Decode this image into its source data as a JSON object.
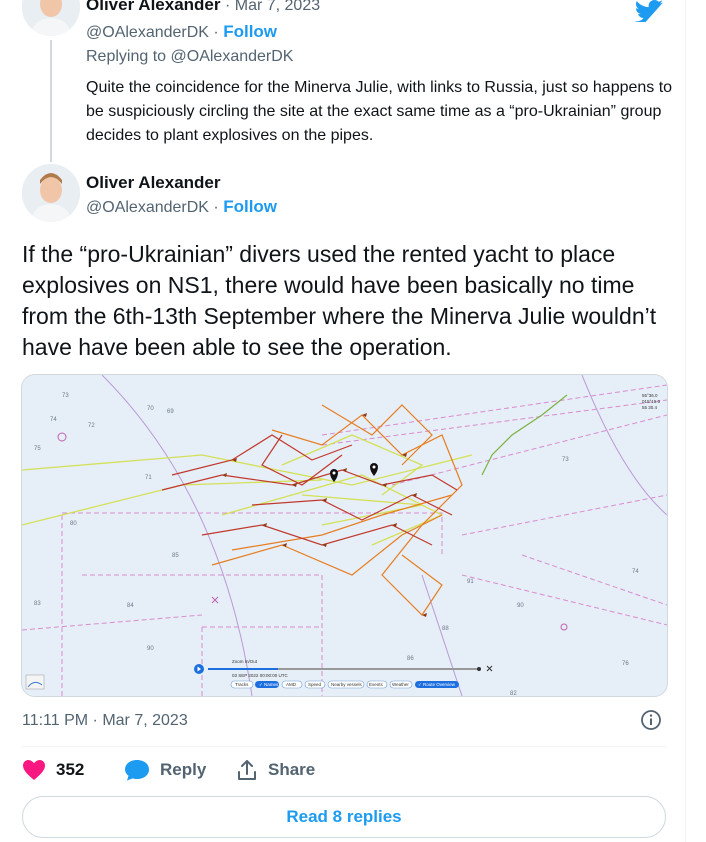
{
  "reply_tweet": {
    "author_name": "Oliver Alexander",
    "date": "Mar 7, 2023",
    "handle": "@OAlexanderDK",
    "follow_label": "Follow",
    "replying_to_prefix": "Replying to",
    "replying_to_handle": "@OAlexanderDK",
    "text": "Quite the coincidence for the Minerva Julie, with links to Russia, just so happens to be suspiciously circling the site at the exact same time as a “pro-Ukrainian” group decides to plant explosives on the pipes."
  },
  "main_tweet": {
    "author_name": "Oliver Alexander",
    "handle": "@OAlexanderDK",
    "follow_label": "Follow",
    "text": "If the “pro-Ukrainian” divers used the rented yacht to place explosives on NS1, there would have been basically no time from the 6th-13th September where the Minerva Julie wouldn’t have have been able to see the operation.",
    "timestamp": "11:11 PM · Mar 7, 2023",
    "likes": "352",
    "reply_label": "Reply",
    "share_label": "Share",
    "read_replies_label": "Read 8 replies"
  },
  "map": {
    "date_label": "03 SEP 2022 00:00:00 UTC",
    "zoom_label": "Zoom In/Out",
    "chips": [
      "Tracks",
      "Names",
      "AMD",
      "Speed",
      "Nearby vessels",
      "Events",
      "Weather",
      "Route Overview"
    ],
    "depths": [
      "73",
      "72",
      "74",
      "75",
      "71",
      "80",
      "82",
      "84",
      "85",
      "86",
      "87",
      "88",
      "89",
      "90",
      "91",
      "76",
      "69"
    ]
  },
  "colors": {
    "accent": "#1d9bf0",
    "heart": "#f91880",
    "track_red": "#c0392b",
    "track_orange": "#e67e22",
    "track_yellow": "#d4e157",
    "track_green": "#7cb342"
  }
}
